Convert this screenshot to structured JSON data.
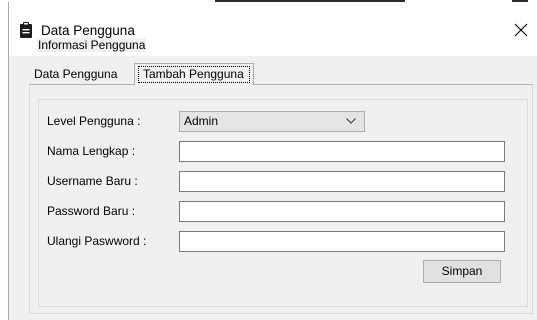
{
  "window": {
    "title": "Data Pengguna",
    "icon": "clipboard-icon",
    "close_icon": "close-icon"
  },
  "tabs": [
    {
      "label": "Data Pengguna",
      "active": false
    },
    {
      "label": "Tambah Pengguna",
      "active": true
    }
  ],
  "group": {
    "title": "Informasi Pengguna"
  },
  "form": {
    "level_label": "Level Pengguna :",
    "level_value": "Admin",
    "nama_label": "Nama Lengkap :",
    "nama_value": "",
    "username_label": "Username Baru :",
    "username_value": "",
    "password_label": "Password Baru :",
    "password_value": "",
    "ulangi_label": "Ulangi Paswword :",
    "ulangi_value": ""
  },
  "buttons": {
    "simpan": "Simpan"
  }
}
